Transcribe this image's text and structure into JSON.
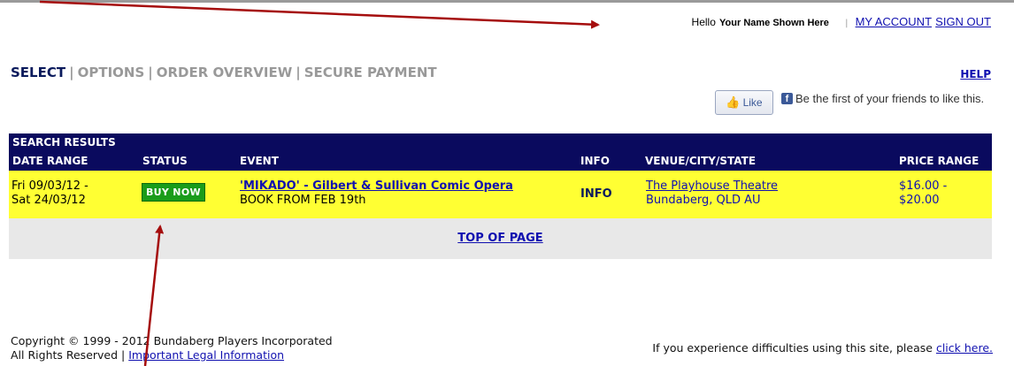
{
  "account": {
    "hello": "Hello",
    "user_name": "Your Name Shown Here",
    "separator": "|",
    "my_account": "MY ACCOUNT",
    "sign_out": "SIGN OUT"
  },
  "steps": {
    "items": [
      "SELECT",
      "OPTIONS",
      "ORDER OVERVIEW",
      "SECURE PAYMENT"
    ],
    "separator": "|",
    "help": "HELP"
  },
  "facebook": {
    "like_label": "Like",
    "fb_letter": "f",
    "social_text": "Be the first of your friends to like this."
  },
  "results": {
    "title": "SEARCH RESULTS",
    "columns": [
      "DATE RANGE",
      "STATUS",
      "EVENT",
      "INFO",
      "VENUE/CITY/STATE",
      "PRICE RANGE"
    ],
    "rows": [
      {
        "date_from": "Fri 09/03/12 -",
        "date_to": "Sat 24/03/12",
        "status": "BUY NOW",
        "event_title": "'MIKADO' - Gilbert & Sullivan Comic Opera",
        "event_sub": "BOOK FROM FEB 19th",
        "info": "INFO",
        "venue": "The Playhouse Theatre",
        "city": "Bundaberg, QLD AU",
        "price_from": "$16.00 -",
        "price_to": "$20.00"
      }
    ],
    "top_of_page": "TOP OF PAGE"
  },
  "footer": {
    "copyright": "Copyright © 1999 - 2012 Bundaberg Players Incorporated",
    "rights": "All Rights Reserved",
    "pipe": "|",
    "legal": "Important Legal Information",
    "difficulty_text": "If you experience difficulties using this site, please",
    "click_here": "click here."
  },
  "colors": {
    "nav_bar": "#0a0a5e",
    "row_highlight": "#ffff33",
    "buy_now": "#1a9c1a",
    "link": "#1010b0",
    "arrow": "#a50d0d"
  }
}
